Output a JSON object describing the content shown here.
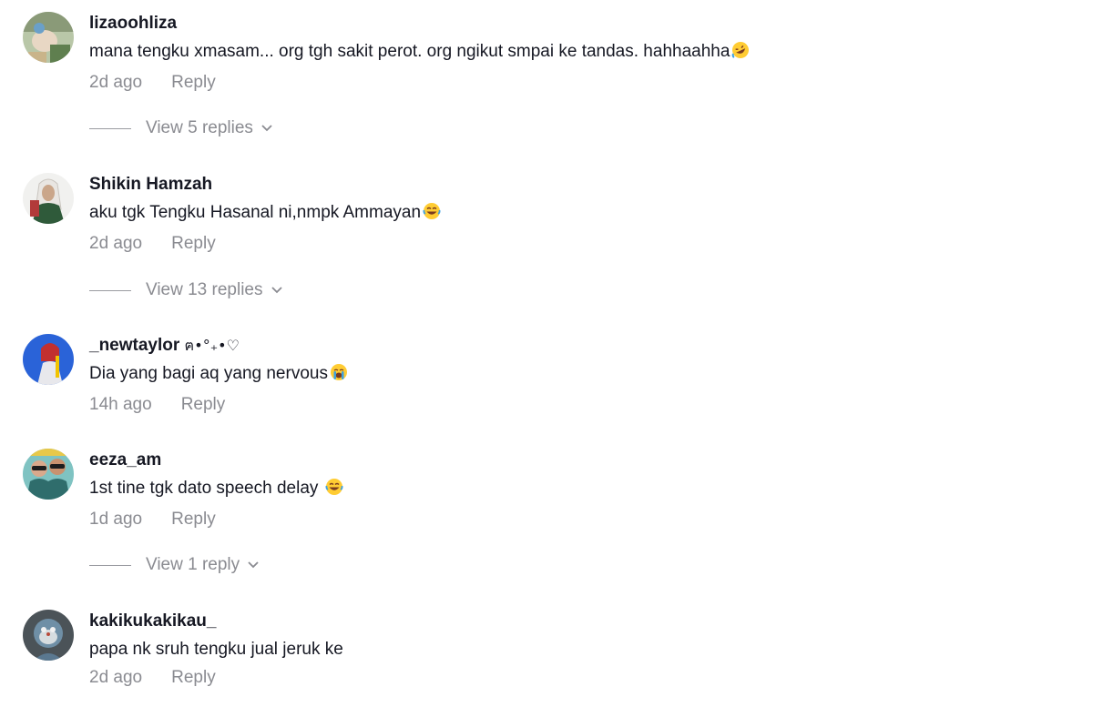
{
  "comments": [
    {
      "username": "lizaoohliza",
      "text": "mana tengku xmasam... org tgh sakit perot. org ngikut smpai ke tandas. hahhaahha",
      "emoji": "rofl",
      "time": "2d ago",
      "reply_label": "Reply",
      "view_replies": "View 5 replies"
    },
    {
      "username": "Shikin Hamzah",
      "text": "aku tgk Tengku Hasanal ni,nmpk Ammayan",
      "emoji": "joy",
      "time": "2d ago",
      "reply_label": "Reply",
      "view_replies": "View 13 replies"
    },
    {
      "username": "_newtaylor",
      "username_decoration": "ฅ•°₊•♡",
      "text": "Dia yang bagi aq yang nervous",
      "emoji": "crying",
      "time": "14h ago",
      "reply_label": "Reply"
    },
    {
      "username": "eeza_am",
      "text": "1st tine tgk dato speech delay ",
      "emoji": "joy",
      "time": "1d ago",
      "reply_label": "Reply",
      "view_replies": "View 1 reply"
    },
    {
      "username": "kakikukakikau_",
      "text": "papa nk sruh tengku jual jeruk ke",
      "time": "2d ago",
      "reply_label": "Reply"
    }
  ],
  "colors": {
    "text": "#161823",
    "muted": "#8a8b91",
    "emoji_face": "#ffcc33"
  }
}
